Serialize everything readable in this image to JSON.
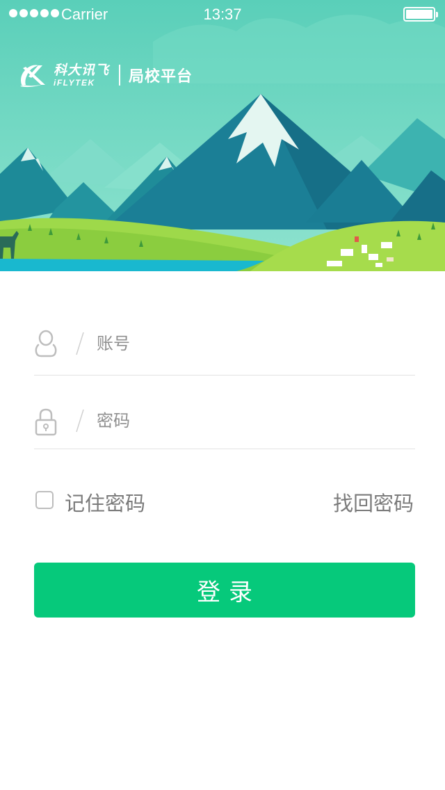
{
  "status_bar": {
    "carrier": "Carrier",
    "time": "13:37",
    "signal_dots": 5
  },
  "brand": {
    "logo_cn": "科大讯飞",
    "logo_en": "iFLYTEK",
    "platform": "局校平台"
  },
  "login_form": {
    "account_placeholder": "账号",
    "account_value": "",
    "password_placeholder": "密码",
    "password_value": "",
    "remember_label": "记住密码",
    "remember_checked": false,
    "forgot_label": "找回密码",
    "submit_label": "登录"
  },
  "icons": {
    "account": "user-icon",
    "password": "lock-icon"
  },
  "colors": {
    "primary": "#06c97b",
    "sky": "#5fd2bd",
    "text_secondary": "#7b7b7b",
    "divider": "#e3e3e3"
  }
}
